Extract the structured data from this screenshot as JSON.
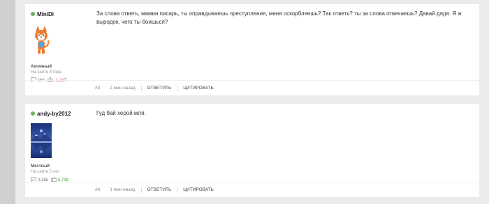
{
  "posts": [
    {
      "username": "MiniDi",
      "rank": "Активный",
      "since": "На сайте 4 года",
      "comments": "164",
      "rating": "-1,217",
      "message": "За слова ответь, мамин писарь, ты оправдываешь преступления, меня оскорбляешь?  Так ответь? ты за слова отвечаешь? Давай дядя. Я ж выродок, чего ты боишься?",
      "number": "#3",
      "time": "2 мин назад",
      "reply": "ОТВЕТИТЬ",
      "quote": "ЦИТИРОВАТЬ"
    },
    {
      "username": "andy-by2012",
      "rank": "Местный",
      "since": "На сайте 5 лет",
      "comments": "2,265",
      "rating": "5,738",
      "message": "Гуд бай херой мля.",
      "number": "#4",
      "time": "1 мин назад",
      "reply": "ОТВЕТИТЬ",
      "quote": "ЦИТИРОВАТЬ"
    }
  ],
  "colors": {
    "online": "#69b55b",
    "negative": "#d53a3a",
    "positive": "#4a9c3b"
  },
  "icons": {
    "comments": "speech-bubble-icon",
    "rating": "thumbs-icon"
  }
}
